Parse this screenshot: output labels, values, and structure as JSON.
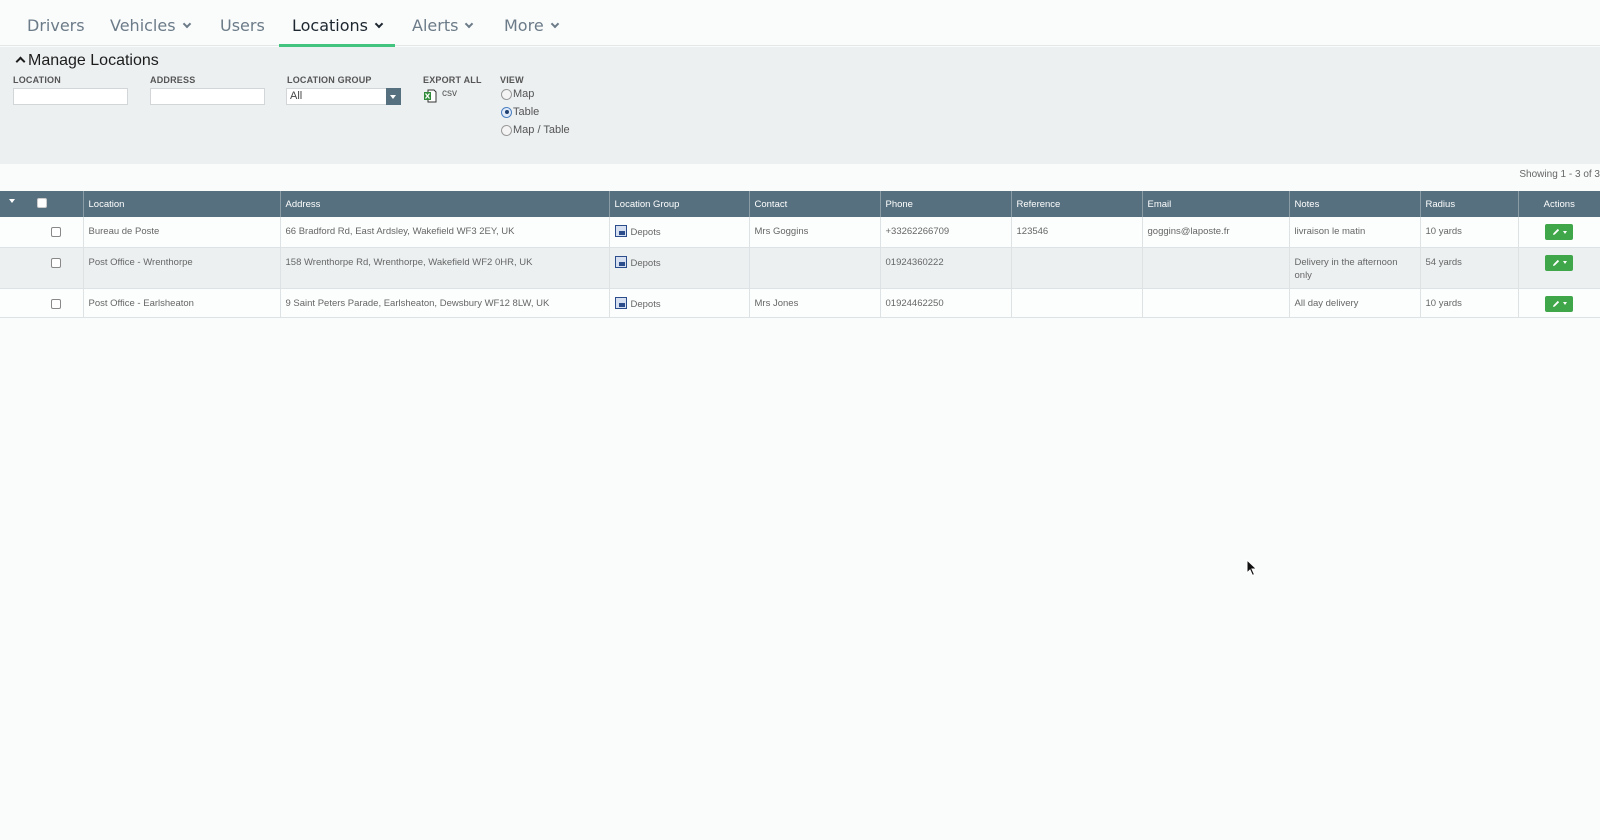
{
  "nav": {
    "items": [
      {
        "label": "Drivers",
        "has_dropdown": false,
        "active": false
      },
      {
        "label": "Vehicles",
        "has_dropdown": true,
        "active": false
      },
      {
        "label": "Users",
        "has_dropdown": false,
        "active": false
      },
      {
        "label": "Locations",
        "has_dropdown": true,
        "active": true
      },
      {
        "label": "Alerts",
        "has_dropdown": true,
        "active": false
      },
      {
        "label": "More",
        "has_dropdown": true,
        "active": false
      }
    ],
    "active_color": "#42c47f"
  },
  "panel": {
    "title": "Manage Locations",
    "filters": {
      "location": {
        "label": "LOCATION",
        "value": ""
      },
      "address": {
        "label": "ADDRESS",
        "value": ""
      },
      "location_group": {
        "label": "LOCATION GROUP",
        "selected": "All"
      },
      "export": {
        "label": "EXPORT ALL",
        "link": "csv"
      },
      "view": {
        "label": "VIEW",
        "options": [
          "Map",
          "Table",
          "Map / Table"
        ],
        "selected": "Table"
      }
    }
  },
  "table": {
    "showing": "Showing 1 - 3 of 3",
    "columns": [
      "Location",
      "Address",
      "Location Group",
      "Contact",
      "Phone",
      "Reference",
      "Email",
      "Notes",
      "Radius",
      "Actions"
    ],
    "rows": [
      {
        "location": "Bureau de Poste",
        "address": "66 Bradford Rd, East Ardsley, Wakefield WF3 2EY, UK",
        "group": "Depots",
        "contact": "Mrs Goggins",
        "phone": "+33262266709",
        "reference": "123546",
        "email": "goggins@laposte.fr",
        "notes": "livraison le matin",
        "radius": "10 yards"
      },
      {
        "location": "Post Office - Wrenthorpe",
        "address": "158 Wrenthorpe Rd, Wrenthorpe, Wakefield WF2 0HR, UK",
        "group": "Depots",
        "contact": "",
        "phone": "01924360222",
        "reference": "",
        "email": "",
        "notes": "Delivery in the afternoon only",
        "radius": "54 yards"
      },
      {
        "location": "Post Office - Earlsheaton",
        "address": "9 Saint Peters Parade, Earlsheaton, Dewsbury WF12 8LW, UK",
        "group": "Depots",
        "contact": "Mrs Jones",
        "phone": "01924462250",
        "reference": "",
        "email": "",
        "notes": "All day delivery",
        "radius": "10 yards"
      }
    ],
    "header_color": "#56707f",
    "action_color": "#3fa64a"
  }
}
